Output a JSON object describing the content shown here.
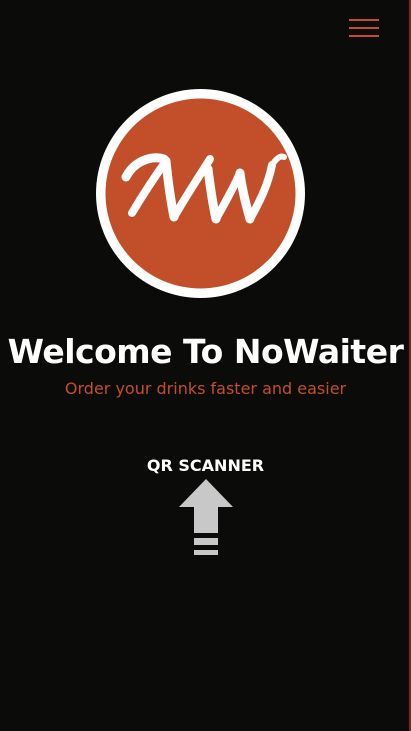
{
  "header": {
    "menu_icon": "hamburger-menu-icon"
  },
  "logo": {
    "text": "NW",
    "brand_color": "#c24f2a"
  },
  "welcome": {
    "title": "Welcome To NoWaiter",
    "subtitle": "Order your drinks faster and easier"
  },
  "qr": {
    "label": "QR SCANNER",
    "icon": "arrow-up-icon"
  },
  "colors": {
    "background": "#0b0c0a",
    "accent": "#c24f2a",
    "text": "#ffffff",
    "arrow": "#c8c8c8"
  }
}
